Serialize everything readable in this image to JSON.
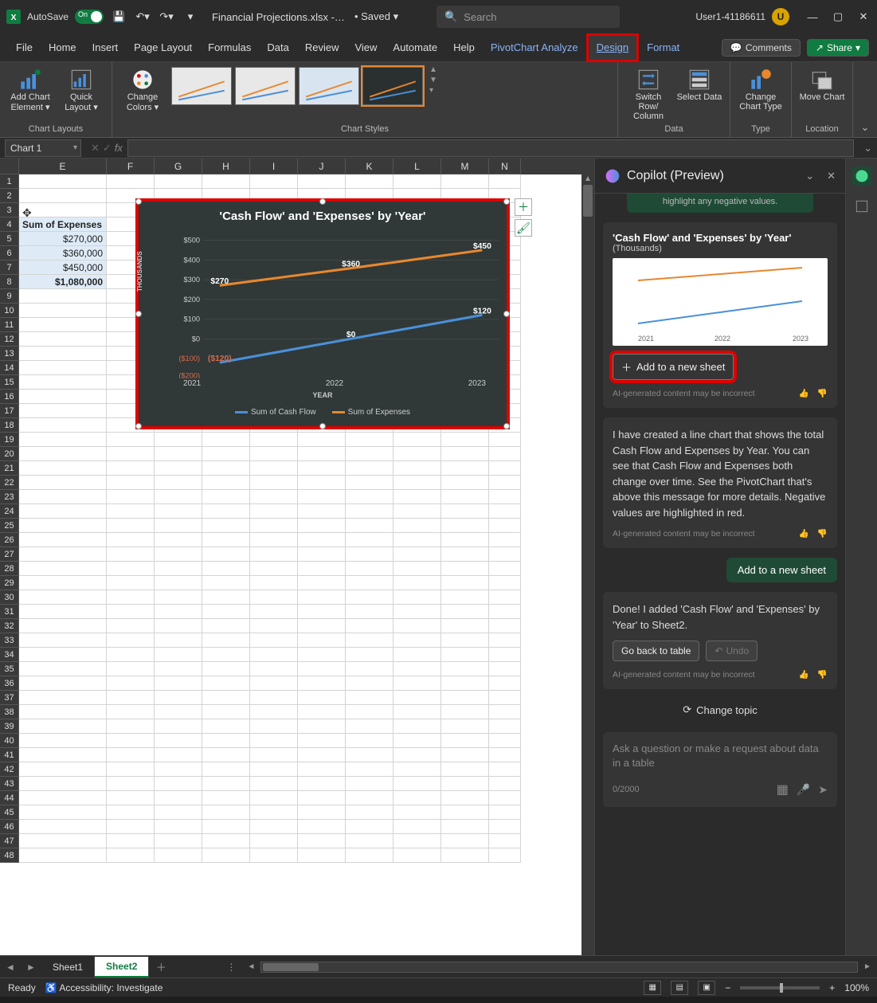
{
  "titlebar": {
    "autosave_label": "AutoSave",
    "autosave_state": "On",
    "filename": "Financial Projections.xlsx -…",
    "saved": "• Saved ▾",
    "search_placeholder": "Search",
    "user_name": "User1-41186611",
    "user_initial": "U"
  },
  "tabs": {
    "file": "File",
    "home": "Home",
    "insert": "Insert",
    "page_layout": "Page Layout",
    "formulas": "Formulas",
    "data": "Data",
    "review": "Review",
    "view": "View",
    "automate": "Automate",
    "help": "Help",
    "pivot": "PivotChart Analyze",
    "design": "Design",
    "format": "Format",
    "comments": "Comments",
    "share": "Share"
  },
  "ribbon": {
    "layouts_label": "Chart Layouts",
    "add_element": "Add Chart Element ▾",
    "quick_layout": "Quick Layout ▾",
    "change_colors": "Change Colors ▾",
    "styles_label": "Chart Styles",
    "switch": "Switch Row/ Column",
    "select_data": "Select Data",
    "data_label": "Data",
    "change_type": "Change Chart Type",
    "type_label": "Type",
    "move_chart": "Move Chart",
    "location_label": "Location"
  },
  "name_box": "Chart 1",
  "fx_label": "fx",
  "columns": [
    "E",
    "F",
    "G",
    "H",
    "I",
    "J",
    "K",
    "L",
    "M",
    "N"
  ],
  "rows": [
    "1",
    "2",
    "3",
    "4",
    "5",
    "6",
    "7",
    "8",
    "9",
    "10",
    "11",
    "12",
    "13",
    "14",
    "15",
    "16",
    "17",
    "18",
    "19",
    "20",
    "21",
    "22",
    "23",
    "24",
    "25",
    "26",
    "27",
    "28",
    "29",
    "30",
    "31",
    "32",
    "33",
    "34",
    "35",
    "36",
    "37",
    "38",
    "39",
    "40",
    "41",
    "42",
    "43",
    "44",
    "45",
    "46",
    "47",
    "48"
  ],
  "table": {
    "header": "Sum of Expenses",
    "r1": "$270,000",
    "r2": "$360,000",
    "r3": "$450,000",
    "total": "$1,080,000"
  },
  "chart": {
    "title": "'Cash Flow' and 'Expenses' by 'Year'",
    "y_axis": "THOUSANDS",
    "x_axis": "YEAR",
    "legend1": "Sum of Cash Flow",
    "legend2": "Sum of Expenses",
    "y_ticks": [
      "$500",
      "$400",
      "$300",
      "$200",
      "$100",
      "$0",
      "($100)",
      "($200)"
    ],
    "x_ticks": [
      "2021",
      "2022",
      "2023"
    ]
  },
  "chart_data": {
    "type": "line",
    "title": "'Cash Flow' and 'Expenses' by 'Year'",
    "xlabel": "YEAR",
    "ylabel": "THOUSANDS",
    "categories": [
      "2021",
      "2022",
      "2023"
    ],
    "series": [
      {
        "name": "Sum of Cash Flow",
        "values": [
          -120,
          0,
          120
        ],
        "color": "#4a90d9",
        "labels": [
          "($120)",
          "$0",
          "$120"
        ]
      },
      {
        "name": "Sum of Expenses",
        "values": [
          270,
          360,
          450
        ],
        "color": "#e8872e",
        "labels": [
          "$270",
          "$360",
          "$450"
        ]
      }
    ],
    "ylim": [
      -200,
      500
    ]
  },
  "copilot": {
    "title": "Copilot (Preview)",
    "truncated": "highlight any negative values.",
    "card1_title": "'Cash Flow' and 'Expenses' by 'Year'",
    "card1_sub": "(Thousands)",
    "mini_x": [
      "2021",
      "2022",
      "2023"
    ],
    "add_btn": "Add to a new sheet",
    "disclaimer": "AI-generated content may be incorrect",
    "msg2": "I have created a line chart that shows the total Cash Flow and Expenses by Year. You can see that Cash Flow and Expenses both change over time. See the PivotChart that's above this message for more details. Negative values are highlighted in red.",
    "user_msg": "Add to a new sheet",
    "msg3": "Done! I added 'Cash Flow' and 'Expenses' by 'Year' to Sheet2.",
    "go_back": "Go back to table",
    "undo": "Undo",
    "change_topic": "Change topic",
    "input_placeholder": "Ask a question or make a request about data in a table",
    "char_count": "0/2000"
  },
  "sheets": {
    "s1": "Sheet1",
    "s2": "Sheet2"
  },
  "status": {
    "ready": "Ready",
    "accessibility": "Accessibility: Investigate",
    "zoom": "100%"
  }
}
